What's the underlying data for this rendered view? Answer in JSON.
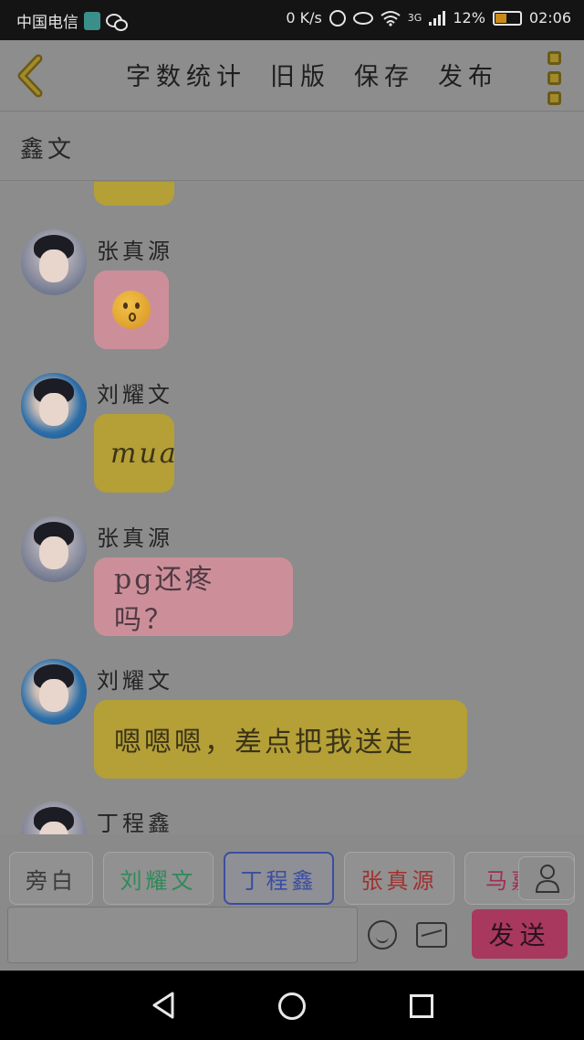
{
  "status_bar": {
    "carrier": "中国电信",
    "net_speed": "0 K/s",
    "network": "3G",
    "battery": "12%",
    "time": "02:06"
  },
  "header": {
    "actions": [
      "字数统计",
      "旧版",
      "保存",
      "发布"
    ],
    "subtitle": "鑫文"
  },
  "messages": [
    {
      "sender": "张真源",
      "type": "emoji",
      "emoji": "kissing-face-icon",
      "color": "pink"
    },
    {
      "sender": "刘耀文",
      "text": "mua",
      "color": "yellow"
    },
    {
      "sender": "张真源",
      "text": "pg还疼吗？",
      "color": "pink"
    },
    {
      "sender": "刘耀文",
      "text": "嗯嗯嗯，差点把我送走",
      "color": "yellow"
    },
    {
      "sender": "丁程鑫"
    }
  ],
  "speakers": [
    {
      "label": "旁白",
      "color": "#3a3a3a"
    },
    {
      "label": "刘耀文",
      "color": "#2e8a5a"
    },
    {
      "label": "丁程鑫",
      "color": "#3a4ea0",
      "active": true
    },
    {
      "label": "张真源",
      "color": "#a0302e"
    },
    {
      "label": "马嘉",
      "color": "#a02e52"
    }
  ],
  "input": {
    "send_label": "发送"
  }
}
